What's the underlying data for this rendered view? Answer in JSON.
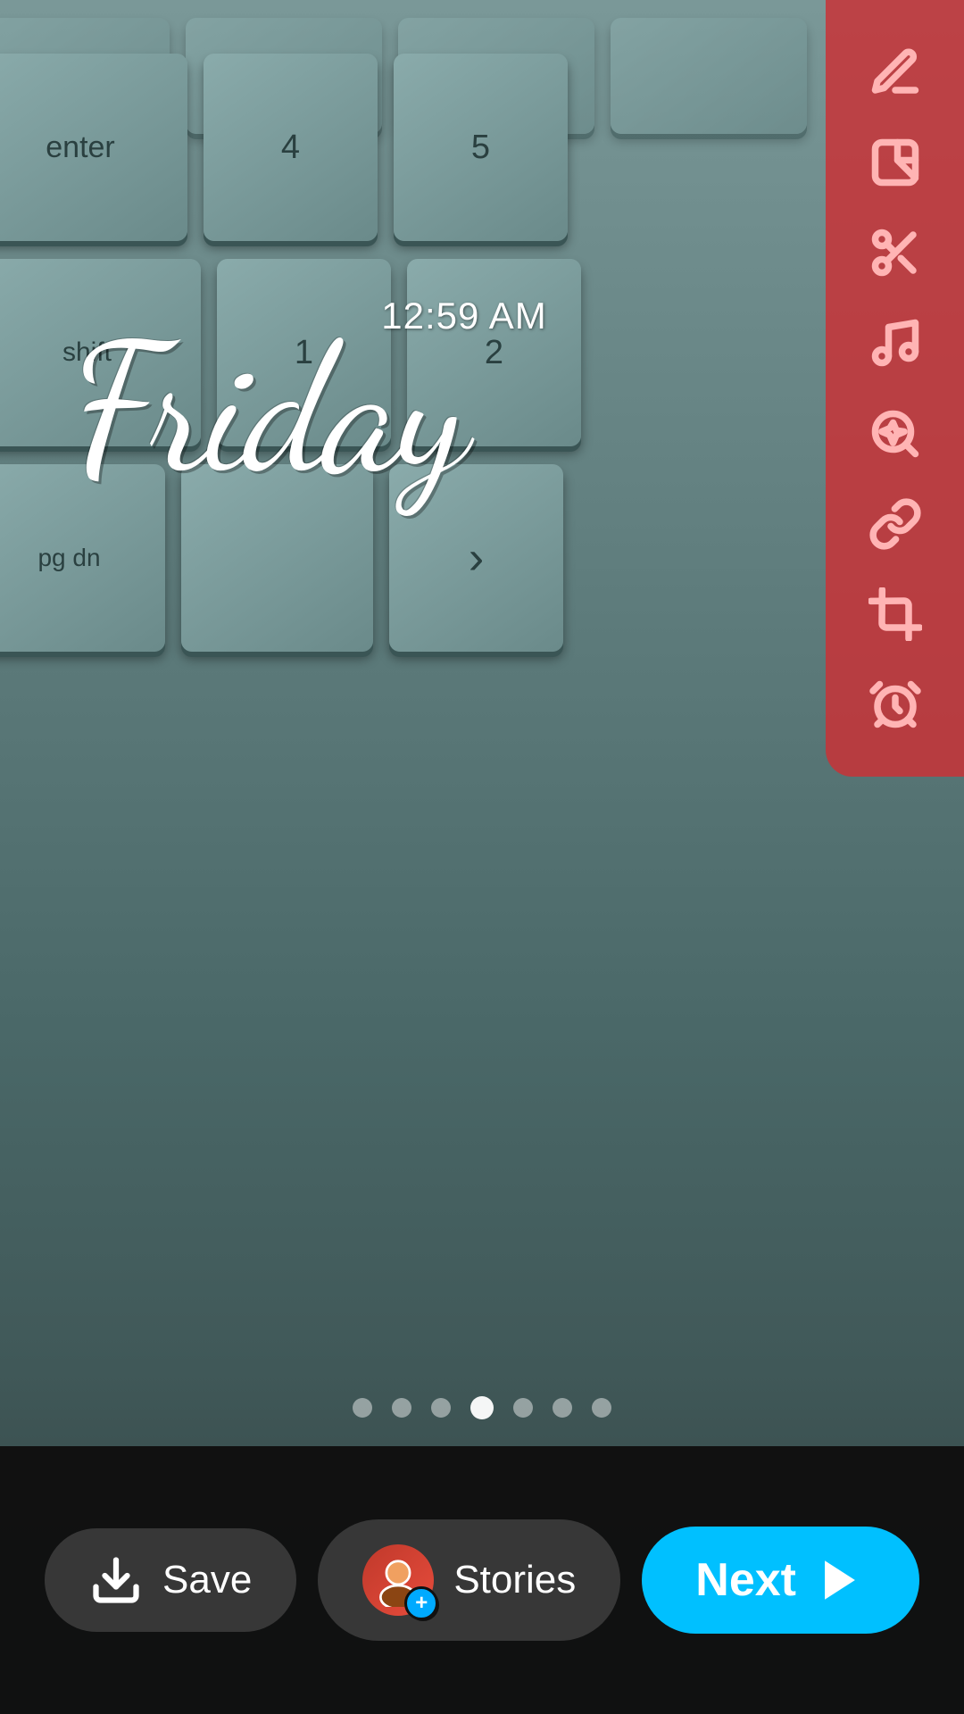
{
  "background": {
    "description": "Blurred keyboard photo background"
  },
  "overlay": {
    "time": "12:59 AM",
    "day": "Friday"
  },
  "toolbar": {
    "icons": [
      {
        "name": "pencil-icon",
        "label": "Draw"
      },
      {
        "name": "sticker-icon",
        "label": "Sticker"
      },
      {
        "name": "scissors-icon",
        "label": "Cut"
      },
      {
        "name": "music-icon",
        "label": "Music"
      },
      {
        "name": "search-star-icon",
        "label": "Search"
      },
      {
        "name": "link-icon",
        "label": "Link"
      },
      {
        "name": "crop-icon",
        "label": "Crop"
      },
      {
        "name": "timer-icon",
        "label": "Timer"
      }
    ]
  },
  "dots": {
    "total": 7,
    "active_index": 3
  },
  "bottom_bar": {
    "save_label": "Save",
    "stories_label": "Stories",
    "next_label": "Next"
  }
}
